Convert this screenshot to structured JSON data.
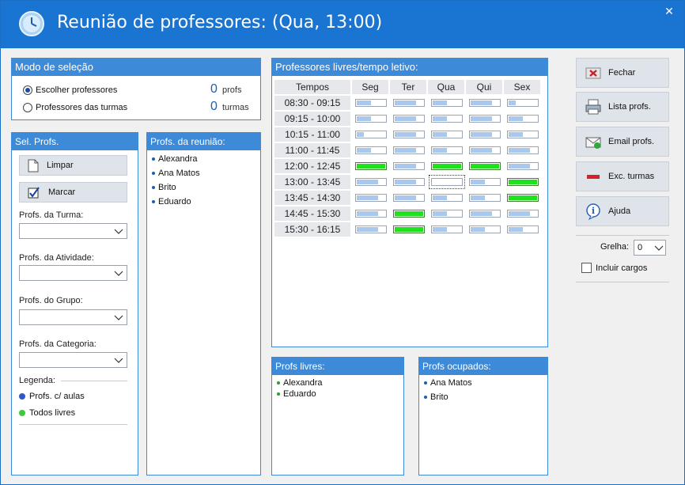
{
  "window": {
    "title": "Reunião de professores: (Qua, 13:00)",
    "close_glyph": "✕"
  },
  "selection_mode": {
    "header": "Modo de seleção",
    "option1": "Escolher professores",
    "option2": "Professores das turmas",
    "count1": "0",
    "count1_label": "profs",
    "count2": "0",
    "count2_label": "turmas"
  },
  "sel_profs": {
    "header": "Sel. Profs.",
    "clear_label": "Limpar",
    "mark_label": "Marcar",
    "turma_label": "Profs. da Turma:",
    "atividade_label": "Profs. da Atividade:",
    "grupo_label": "Profs. do Grupo:",
    "categoria_label": "Profs. da Categoria:",
    "legend_label": "Legenda:",
    "legend1": "Profs. c/ aulas",
    "legend2": "Todos livres",
    "legend1_color": "#2f57c9",
    "legend2_color": "#3ccb3c"
  },
  "meeting_profs": {
    "header": "Profs. da reunião:",
    "items": [
      "Alexandra",
      "Ana Matos",
      "Brito",
      "Eduardo"
    ]
  },
  "free_grid": {
    "header": "Professores livres/tempo letivo:",
    "corner": "Tempos",
    "days": [
      "Seg",
      "Ter",
      "Qua",
      "Qui",
      "Sex"
    ],
    "times": [
      "08:30 - 09:15",
      "09:15 - 10:00",
      "10:15 - 11:00",
      "11:00 - 11:45",
      "12:00 - 12:45",
      "13:00 - 13:45",
      "13:45 - 14:30",
      "14:45 - 15:30",
      "15:30 - 16:15"
    ],
    "free_fraction": [
      [
        0.5,
        0.75,
        0.5,
        0.75,
        0.25
      ],
      [
        0.5,
        0.75,
        0.5,
        0.75,
        0.5
      ],
      [
        0.25,
        0.75,
        0.5,
        0.75,
        0.5
      ],
      [
        0.5,
        0.75,
        0.5,
        0.75,
        0.75
      ],
      [
        1,
        0.75,
        1,
        1,
        0.75
      ],
      [
        0.75,
        0.75,
        0.0,
        0.5,
        1
      ],
      [
        0.75,
        0.75,
        0.5,
        0.5,
        1
      ],
      [
        0.75,
        1,
        0.5,
        0.75,
        0.75
      ],
      [
        0.75,
        1,
        0.5,
        0.5,
        0.5
      ]
    ],
    "selected": {
      "row": 5,
      "col": 2
    }
  },
  "free_profs": {
    "header": "Profs livres:",
    "items": [
      "Alexandra",
      "Eduardo"
    ]
  },
  "busy_profs": {
    "header": "Profs ocupados:",
    "items": [
      "Ana Matos",
      "Brito"
    ]
  },
  "actions": {
    "close": "Fechar",
    "list": "Lista profs.",
    "email": "Email profs.",
    "exc": "Exc. turmas",
    "help": "Ajuda"
  },
  "grelha": {
    "label": "Grelha:",
    "value": "0"
  },
  "incluir_cargos": "Incluir cargos"
}
